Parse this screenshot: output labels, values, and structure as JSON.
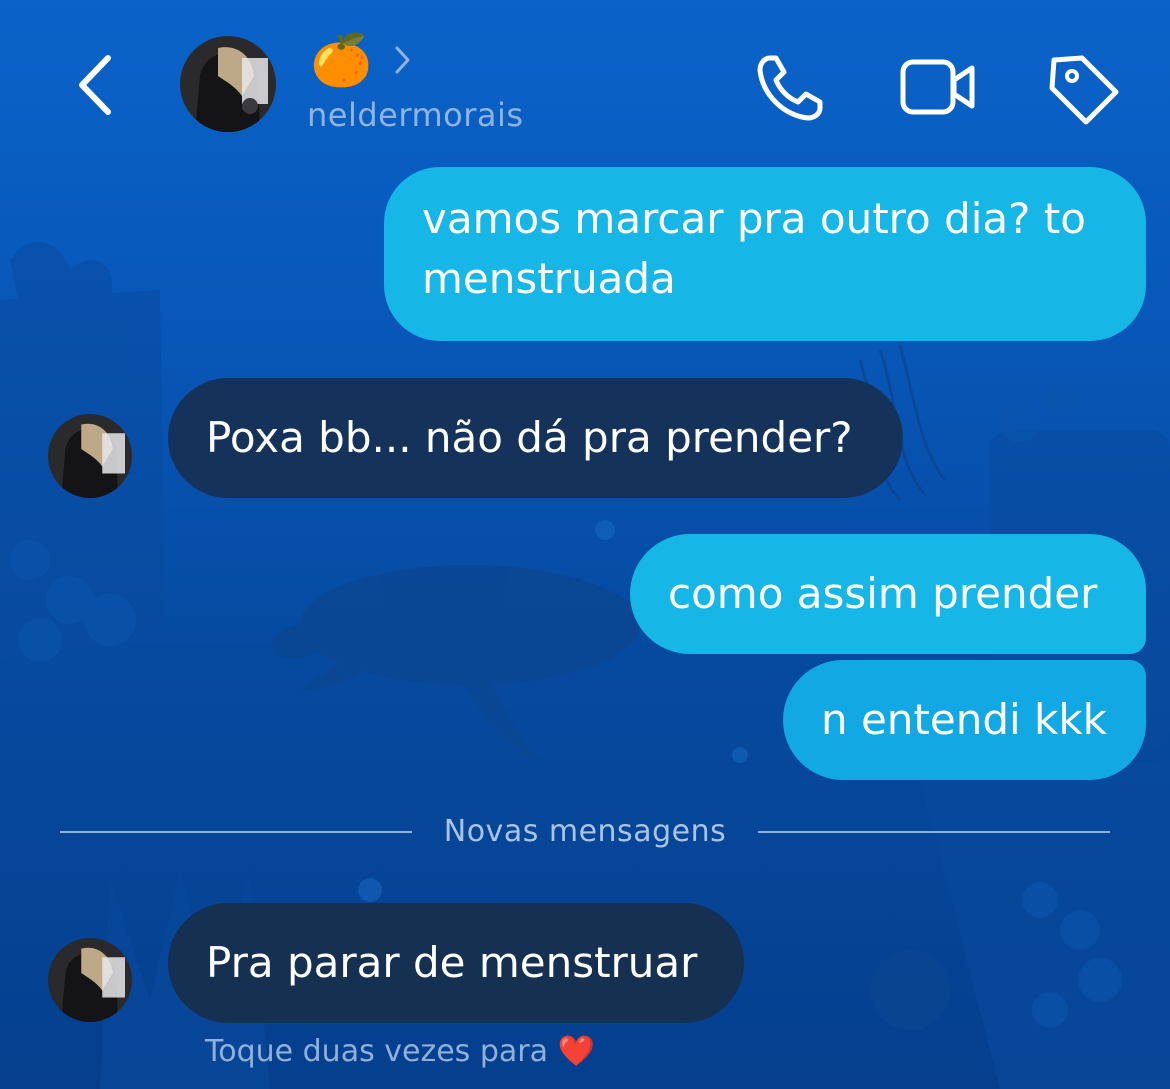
{
  "header": {
    "title_emoji": "🍊",
    "username": "neldermorais",
    "icons": {
      "back": "back-chevron-icon",
      "call": "phone-icon",
      "video": "video-camera-icon",
      "tag": "tag-icon",
      "title_chevron": "chevron-right-icon"
    }
  },
  "messages": [
    {
      "direction": "outgoing",
      "text_line1": "vamos marcar pra outro dia? to",
      "text_line2": "menstruada"
    },
    {
      "direction": "incoming",
      "text": "Poxa bb... não dá pra prender?"
    },
    {
      "direction": "outgoing",
      "text": "como assim prender"
    },
    {
      "direction": "outgoing",
      "text": "n entendi kkk"
    },
    {
      "direction": "incoming",
      "text": "Pra parar de menstruar"
    }
  ],
  "divider": {
    "label": "Novas mensagens"
  },
  "footer": {
    "hint": "Toque duas vezes para",
    "hint_emoji": "❤️"
  },
  "colors": {
    "background": "#0857b8",
    "outgoing_bubble": "#16b7e6",
    "incoming_bubble": "#15335a",
    "text": "#ffffff",
    "muted_text": "#8fb0d8"
  }
}
